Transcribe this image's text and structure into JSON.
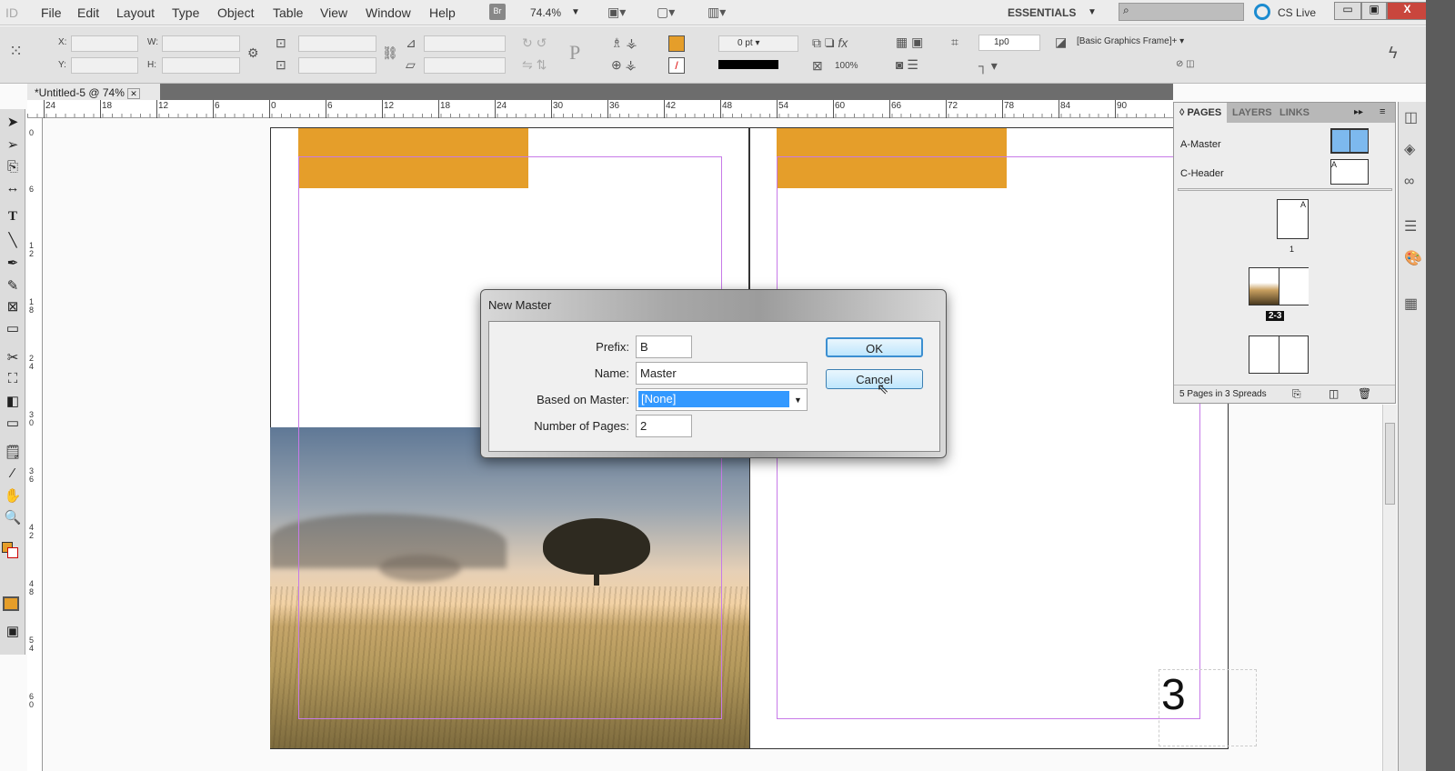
{
  "app": {
    "logo": "ID",
    "menus": [
      "File",
      "Edit",
      "Layout",
      "Type",
      "Object",
      "Table",
      "View",
      "Window",
      "Help"
    ],
    "bridge": "Br",
    "zoom": "74.4%",
    "workspace": "ESSENTIALS",
    "search_placeholder": "",
    "cs_live": "CS Live"
  },
  "control": {
    "x_label": "X:",
    "y_label": "Y:",
    "w_label": "W:",
    "h_label": "H:",
    "stroke_weight": "0 pt",
    "opacity": "100%",
    "spacing": "1p0",
    "object_style": "[Basic Graphics Frame]+",
    "fill_color": "#e59e2a"
  },
  "document": {
    "tab_title": "*Untitled-5 @ 74%",
    "page_number": "3"
  },
  "ruler": {
    "h_labels": [
      "24",
      "18",
      "12",
      "6",
      "0",
      "6",
      "12",
      "18",
      "24",
      "30",
      "36",
      "42",
      "48",
      "54",
      "60",
      "66",
      "72",
      "78",
      "84",
      "90"
    ],
    "v_labels": [
      "0",
      "6",
      "1 2",
      "1 8",
      "2 4",
      "3 0",
      "3 6",
      "4 2",
      "4 8",
      "5 4",
      "6 0"
    ]
  },
  "pages_panel": {
    "tabs": [
      "PAGES",
      "LAYERS",
      "LINKS"
    ],
    "masters": [
      {
        "name": "A-Master"
      },
      {
        "name": "C-Header"
      }
    ],
    "page_labels": [
      "1",
      "2-3"
    ],
    "status": "5 Pages in 3 Spreads",
    "prefix_a": "A",
    "prefix_c": "C"
  },
  "dialog": {
    "title": "New Master",
    "prefix_label": "Prefix:",
    "prefix_value": "B",
    "name_label": "Name:",
    "name_value": "Master",
    "based_label": "Based on Master:",
    "based_value": "[None]",
    "pages_label": "Number of Pages:",
    "pages_value": "2",
    "ok": "OK",
    "cancel": "Cancel"
  }
}
